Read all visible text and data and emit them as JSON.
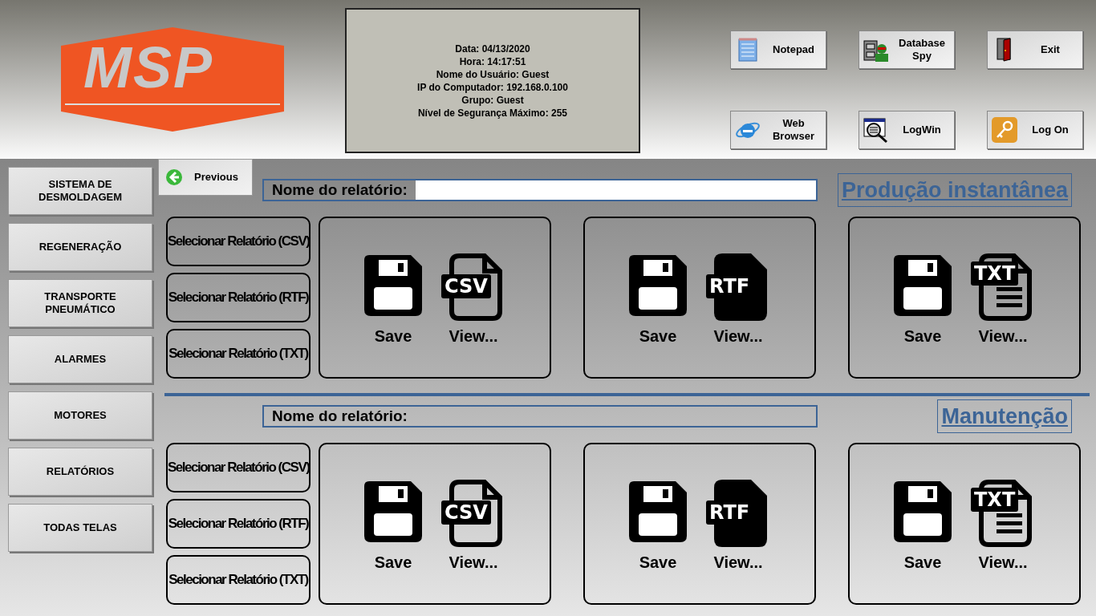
{
  "logo": {
    "text": "MSP"
  },
  "info": [
    "Data: 04/13/2020",
    "Hora: 14:17:51",
    "Nome do Usuário: Guest",
    "IP do Computador: 192.168.0.100",
    "Grupo: Guest",
    "Nível de Segurança Máximo: 255"
  ],
  "toolbar": [
    {
      "label": "Notepad",
      "kind": "notepad"
    },
    {
      "label": "Database Spy",
      "kind": "spy"
    },
    {
      "label": "Exit",
      "kind": "exit"
    },
    {
      "label": "Web Browser",
      "kind": "browser"
    },
    {
      "label": "LogWin",
      "kind": "logwin"
    },
    {
      "label": "Log On",
      "kind": "key"
    }
  ],
  "sidebar": [
    "SISTEMA DE DESMOLDAGEM",
    "REGENERAÇÃO",
    "TRANSPORTE PNEUMÁTICO",
    "ALARMES",
    "MOTORES",
    "RELATÓRIOS",
    "TODAS TELAS"
  ],
  "previous": "Previous",
  "sections": [
    {
      "title": "Produção instantânea",
      "name_label": "Nome do relatório:",
      "input_shown": true,
      "selectors": [
        "Selecionar Relatório (CSV)",
        "Selecionar Relatório (RTF)",
        "Selecionar Relatório (TXT)"
      ],
      "panels": [
        {
          "save": "Save",
          "view": "View...",
          "badge": "CSV",
          "kind": "outline"
        },
        {
          "save": "Save",
          "view": "View...",
          "badge": "RTF",
          "kind": "solid"
        },
        {
          "save": "Save",
          "view": "View...",
          "badge": "TXT",
          "kind": "lines"
        }
      ]
    },
    {
      "title": "Manutenção",
      "name_label": "Nome do relatório:",
      "input_shown": false,
      "selectors": [
        "Selecionar Relatório (CSV)",
        "Selecionar Relatório (RTF)",
        "Selecionar Relatório (TXT)"
      ],
      "panels": [
        {
          "save": "Save",
          "view": "View...",
          "badge": "CSV",
          "kind": "outline"
        },
        {
          "save": "Save",
          "view": "View...",
          "badge": "RTF",
          "kind": "solid"
        },
        {
          "save": "Save",
          "view": "View...",
          "badge": "TXT",
          "kind": "lines"
        }
      ]
    }
  ]
}
